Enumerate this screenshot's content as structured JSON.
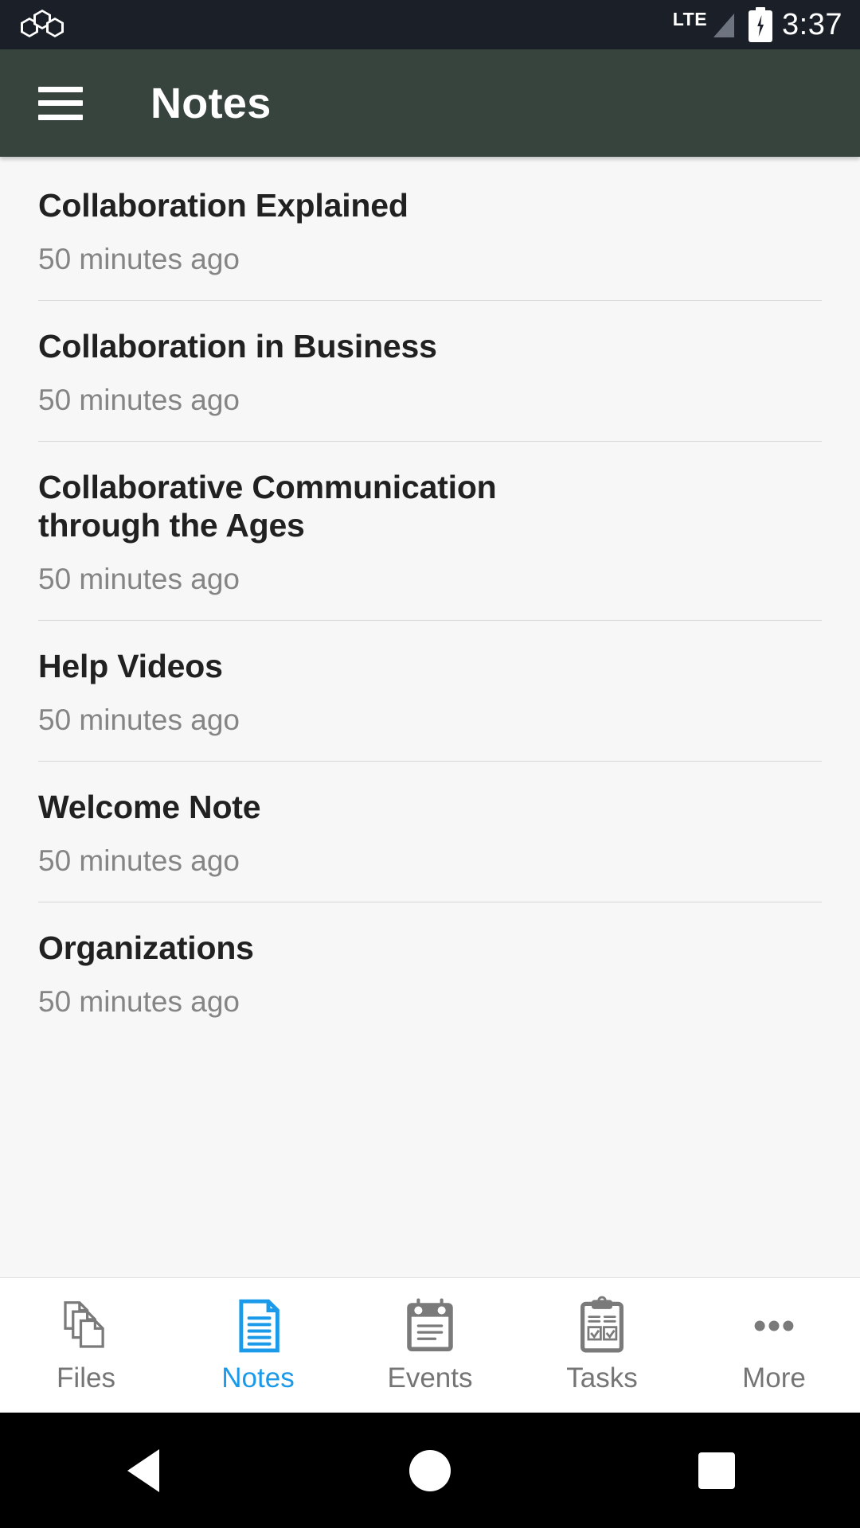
{
  "status_bar": {
    "app_icon": "hexagon-cluster-icon",
    "network_label": "LTE",
    "signal_icon": "signal-triangle-icon",
    "battery_icon": "battery-charging-icon",
    "time": "3:37"
  },
  "app_bar": {
    "menu_icon": "hamburger-menu-icon",
    "title": "Notes",
    "background": "#36443d"
  },
  "notes": [
    {
      "title": "Collaboration Explained",
      "time": "50 minutes ago"
    },
    {
      "title": "Collaboration in Business",
      "time": "50 minutes ago"
    },
    {
      "title": "Collaborative Communication through the Ages",
      "time": "50 minutes ago"
    },
    {
      "title": "Help Videos",
      "time": "50 minutes ago"
    },
    {
      "title": "Welcome Note",
      "time": "50 minutes ago"
    },
    {
      "title": "Organizations",
      "time": "50 minutes ago"
    }
  ],
  "tab_bar": {
    "active_color": "#1a9ae8",
    "inactive_color": "#757575",
    "tabs": [
      {
        "label": "Files",
        "icon": "documents-stack-icon",
        "active": false
      },
      {
        "label": "Notes",
        "icon": "note-document-icon",
        "active": true
      },
      {
        "label": "Events",
        "icon": "calendar-icon",
        "active": false
      },
      {
        "label": "Tasks",
        "icon": "clipboard-checks-icon",
        "active": false
      },
      {
        "label": "More",
        "icon": "three-dots-icon",
        "active": false
      }
    ]
  },
  "android_nav": {
    "back": "back-triangle-icon",
    "home": "home-circle-icon",
    "recent": "recent-square-icon"
  }
}
